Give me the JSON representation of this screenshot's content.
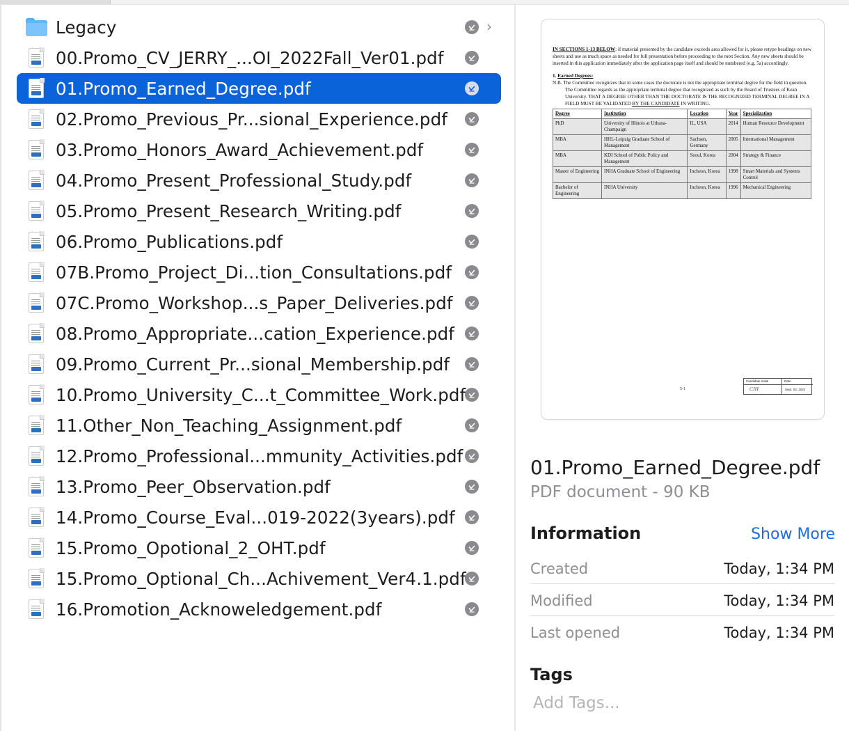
{
  "colors": {
    "selection": "#0a63d8",
    "link": "#1a6fe0",
    "muted_text": "#8e8e93",
    "status_badge": "#8a8a8e"
  },
  "files": [
    {
      "name": "Legacy",
      "kind": "folder-icon",
      "selected": false,
      "has_chevron": true
    },
    {
      "name": "00.Promo_CV_JERRY_...OI_2022Fall_Ver01.pdf",
      "kind": "pdf-document-icon",
      "selected": false
    },
    {
      "name": "01.Promo_Earned_Degree.pdf",
      "kind": "pdf-document-icon",
      "selected": true
    },
    {
      "name": "02.Promo_Previous_Pr...sional_Experience.pdf",
      "kind": "pdf-document-icon",
      "selected": false
    },
    {
      "name": "03.Promo_Honors_Award_Achievement.pdf",
      "kind": "pdf-document-icon",
      "selected": false
    },
    {
      "name": "04.Promo_Present_Professional_Study.pdf",
      "kind": "pdf-document-icon",
      "selected": false
    },
    {
      "name": "05.Promo_Present_Research_Writing.pdf",
      "kind": "pdf-document-icon",
      "selected": false
    },
    {
      "name": "06.Promo_Publications.pdf",
      "kind": "pdf-document-icon",
      "selected": false
    },
    {
      "name": "07B.Promo_Project_Di...tion_Consultations.pdf",
      "kind": "pdf-document-icon",
      "selected": false
    },
    {
      "name": "07C.Promo_Workshop...s_Paper_Deliveries.pdf",
      "kind": "pdf-document-icon",
      "selected": false
    },
    {
      "name": "08.Promo_Appropriate...cation_Experience.pdf",
      "kind": "pdf-document-icon",
      "selected": false
    },
    {
      "name": "09.Promo_Current_Pr...sional_Membership.pdf",
      "kind": "pdf-document-icon",
      "selected": false
    },
    {
      "name": "10.Promo_University_C...t_Committee_Work.pdf",
      "kind": "pdf-document-icon",
      "selected": false
    },
    {
      "name": "11.Other_Non_Teaching_Assignment.pdf",
      "kind": "pdf-document-icon",
      "selected": false
    },
    {
      "name": "12.Promo_Professional...mmunity_Activities.pdf",
      "kind": "pdf-document-icon",
      "selected": false
    },
    {
      "name": "13.Promo_Peer_Observation.pdf",
      "kind": "pdf-document-icon",
      "selected": false
    },
    {
      "name": "14.Promo_Course_Eval...019-2022(3years).pdf",
      "kind": "pdf-document-icon",
      "selected": false
    },
    {
      "name": "15.Promo_Opotional_2_OHT.pdf",
      "kind": "pdf-document-icon",
      "selected": false
    },
    {
      "name": "15.Promo_Optional_Ch...Achivement_Ver4.1.pdf",
      "kind": "pdf-document-icon",
      "selected": false
    },
    {
      "name": "16.Promotion_Acknoweledgement.pdf",
      "kind": "pdf-document-icon",
      "selected": false
    }
  ],
  "preview": {
    "document": {
      "intro_heading": "IN SECTIONS 1-13 BELOW",
      "intro_text": ": if material presented by the candidate exceeds area allowed for it, please retype headings on new sheets and use as much space as needed for full presentation before proceeding to the next Section.  Any new sheets should be inserted in this application immediately after the application page itself and should be numbered (e.g. 5a) accordingly.",
      "section_number": "1.",
      "section_title": "Earned Degrees:",
      "note_text": "N.B. The Committee recognizes that in some cases the doctorate is not the appropriate terminal degree for the field in question.  The Committee regards as the appropriate terminal degree that recognized as such by the Board of Trustees of Kean University.  THAT A DEGREE OTHER THAN THE DOCTORATE IS THE RECOGNIZED TERMINAL DEGREE IN A FIELD MUST BE VALIDATED ",
      "note_tail_underlined": "BY THE CANDIDATE",
      "note_tail": " IN WRITING.",
      "table_headers": [
        "Degree",
        "Institution",
        "Location",
        "Year",
        "Specialization"
      ],
      "table_rows": [
        [
          "PhD",
          "University of Illinois at Urbana-Champaign",
          "IL, USA",
          "2014",
          "Human Resource Development"
        ],
        [
          "MBA",
          "HHL-Leipzig Graduate School of Management",
          "Sachsen, Germany",
          "2005",
          "International Management"
        ],
        [
          "MBA",
          "KDI School of Public Policy and Management",
          "Seoul, Korea",
          "2004",
          "Strategy & Finance"
        ],
        [
          "Master of Engineering",
          "INHA Graduate School of Engineering",
          "Incheon, Korea",
          "1998",
          "Smart Materials and Systems Control"
        ],
        [
          "Bachelor of Engineering",
          "INHA University",
          "Incheon, Korea",
          "1996",
          "Mechanical Engineering"
        ]
      ],
      "page_number": "5-1",
      "sig_initial_label": "Candidate Initial",
      "sig_date_label": "Date",
      "sig_initial_value": "CJH",
      "sig_date_value": "Sept. 03, 2022"
    },
    "file_name": "01.Promo_Earned_Degree.pdf",
    "file_type": "PDF document - 90 KB",
    "information_heading": "Information",
    "show_more_label": "Show More",
    "info": [
      {
        "label": "Created",
        "value": "Today, 1:34 PM"
      },
      {
        "label": "Modified",
        "value": "Today, 1:34 PM"
      },
      {
        "label": "Last opened",
        "value": "Today, 1:34 PM"
      }
    ],
    "tags_heading": "Tags",
    "tags_placeholder": "Add Tags..."
  }
}
